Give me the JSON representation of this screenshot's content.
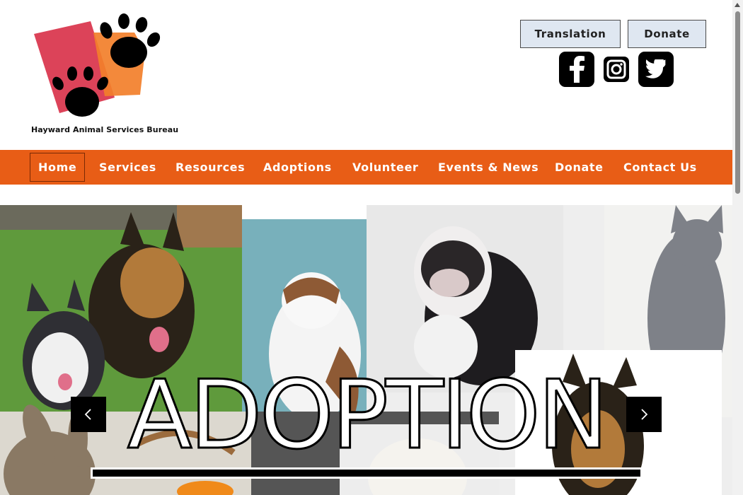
{
  "brand": {
    "name": "Hayward Animal Services Bureau"
  },
  "header_buttons": {
    "translation": "Translation",
    "donate": "Donate"
  },
  "social": [
    "facebook-icon",
    "instagram-icon",
    "twitter-icon"
  ],
  "nav": {
    "items": [
      {
        "label": "Home",
        "active": true
      },
      {
        "label": "Services"
      },
      {
        "label": "Resources"
      },
      {
        "label": "Adoptions"
      },
      {
        "label": "Volunteer"
      },
      {
        "label": "Events & News"
      },
      {
        "label": "Donate"
      },
      {
        "label": "Contact Us"
      }
    ]
  },
  "hero": {
    "title": "ADOPTION",
    "prev_icon": "chevron-left-icon",
    "next_icon": "chevron-right-icon"
  },
  "colors": {
    "nav_bg": "#e85d16",
    "button_bg": "#dfe7f1",
    "paw_red": "#d9334b",
    "paw_orange": "#f27f2a"
  }
}
